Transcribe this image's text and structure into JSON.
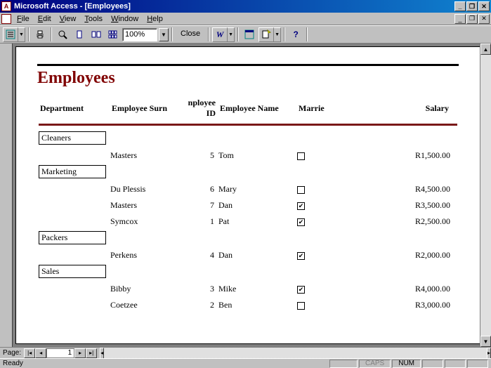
{
  "titlebar": {
    "text": "Microsoft Access - [Employees]"
  },
  "menu": {
    "file": "File",
    "edit": "Edit",
    "view": "View",
    "tools": "Tools",
    "window": "Window",
    "help": "Help"
  },
  "toolbar": {
    "zoom": "100%",
    "close_label": "Close"
  },
  "report": {
    "title": "Employees",
    "columns": {
      "department": "Department",
      "surname": "Employee Surn",
      "id": "nployee ID",
      "name": "Employee Name",
      "married": "Marrie",
      "salary": "Salary"
    },
    "groups": [
      {
        "department": "Cleaners",
        "rows": [
          {
            "surname": "Masters",
            "id": "5",
            "name": "Tom",
            "married": false,
            "salary": "R1,500.00"
          }
        ]
      },
      {
        "department": "Marketing",
        "rows": [
          {
            "surname": "Du Plessis",
            "id": "6",
            "name": "Mary",
            "married": false,
            "salary": "R4,500.00"
          },
          {
            "surname": "Masters",
            "id": "7",
            "name": "Dan",
            "married": true,
            "salary": "R3,500.00"
          },
          {
            "surname": "Symcox",
            "id": "1",
            "name": "Pat",
            "married": true,
            "salary": "R2,500.00"
          }
        ]
      },
      {
        "department": "Packers",
        "rows": [
          {
            "surname": "Perkens",
            "id": "4",
            "name": "Dan",
            "married": true,
            "salary": "R2,000.00"
          }
        ]
      },
      {
        "department": "Sales",
        "rows": [
          {
            "surname": "Bibby",
            "id": "3",
            "name": "Mike",
            "married": true,
            "salary": "R4,000.00"
          },
          {
            "surname": "Coetzee",
            "id": "2",
            "name": "Ben",
            "married": false,
            "salary": "R3,000.00"
          }
        ]
      }
    ]
  },
  "nav": {
    "label": "Page:",
    "current": "1"
  },
  "status": {
    "ready": "Ready",
    "caps": "CAPS",
    "num": "NUM"
  }
}
